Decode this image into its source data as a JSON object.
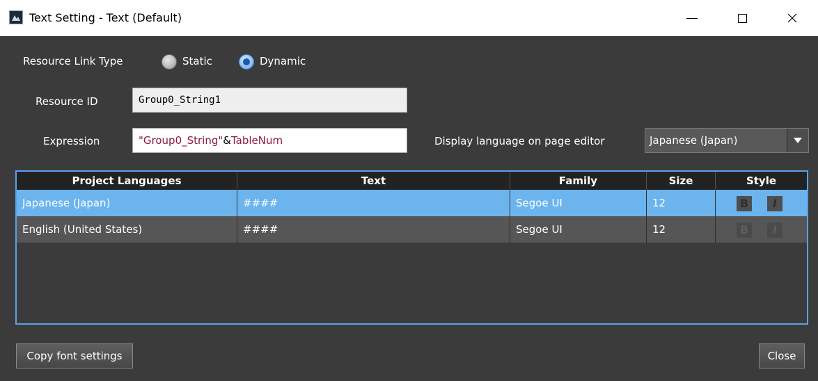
{
  "window": {
    "title": "Text Setting - Text (Default)"
  },
  "resource_link_type": {
    "label": "Resource Link Type",
    "options": [
      {
        "label": "Static",
        "selected": false
      },
      {
        "label": "Dynamic",
        "selected": true
      }
    ]
  },
  "resource_id": {
    "label": "Resource ID",
    "value": "Group0_String1"
  },
  "expression": {
    "label": "Expression",
    "string_part": "\"Group0_String\"",
    "operator": "&",
    "variable": "TableNum"
  },
  "display_language": {
    "label": "Display language on page editor",
    "value": "Japanese (Japan)"
  },
  "table": {
    "columns": [
      "Project Languages",
      "Text",
      "Family",
      "Size",
      "Style"
    ],
    "rows": [
      {
        "language": "Japanese (Japan)",
        "text": "####",
        "family": "Segoe UI",
        "size": "12",
        "selected": true
      },
      {
        "language": "English (United States)",
        "text": "####",
        "family": "Segoe UI",
        "size": "12",
        "selected": false
      }
    ],
    "style_bold": "B",
    "style_italic": "I"
  },
  "buttons": {
    "copy_font": "Copy font settings",
    "close": "Close"
  },
  "colors": {
    "background": "#3b3b3b",
    "selected_row": "#6bb4ee",
    "table_border": "#5aa0e8",
    "expression_text": "#8b1a3a"
  }
}
